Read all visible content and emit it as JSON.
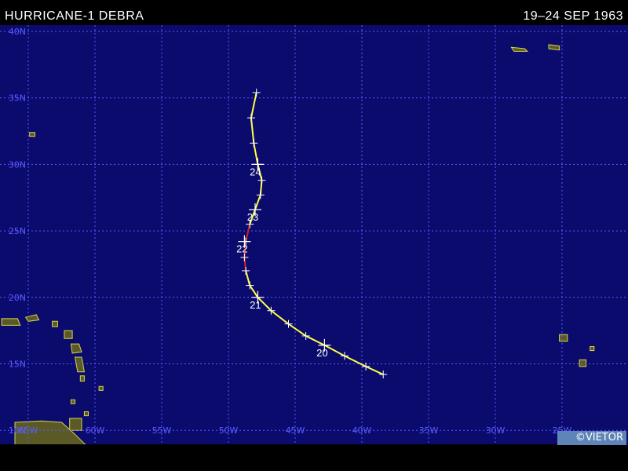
{
  "header": {
    "storm_title": "HURRICANE-1 DEBRA",
    "date_range": "19–24 SEP 1963"
  },
  "credit": "©VIETOR",
  "colors": {
    "ocean": "#0b0b6e",
    "grid": "#5a5aff",
    "land_fill": "#5b5a27",
    "land_outline": "#d6d64a",
    "track_hurricane": "#ffff44",
    "track_storm": "#cc2222",
    "tick": "#ffffff"
  },
  "axes": {
    "lat_labels": [
      "40N",
      "35N",
      "30N",
      "25N",
      "20N",
      "15N",
      "10N"
    ],
    "lon_labels": [
      "65W",
      "60W",
      "55W",
      "50W",
      "45W",
      "40W",
      "35W",
      "30W",
      "25W"
    ]
  },
  "track": {
    "day_labels": [
      {
        "day": "20",
        "lat": 16.4,
        "lon": -42.8
      },
      {
        "day": "21",
        "lat": 20.0,
        "lon": -47.8
      },
      {
        "day": "22",
        "lat": 24.2,
        "lon": -48.8
      },
      {
        "day": "23",
        "lat": 26.6,
        "lon": -48.0
      },
      {
        "day": "24",
        "lat": 30.0,
        "lon": -47.8
      }
    ],
    "points": [
      {
        "lat": 14.2,
        "lon": -38.4,
        "cat": "H"
      },
      {
        "lat": 14.8,
        "lon": -39.7,
        "cat": "H"
      },
      {
        "lat": 15.6,
        "lon": -41.3,
        "cat": "H"
      },
      {
        "lat": 16.4,
        "lon": -42.8,
        "cat": "H"
      },
      {
        "lat": 17.1,
        "lon": -44.2,
        "cat": "H"
      },
      {
        "lat": 18.0,
        "lon": -45.5,
        "cat": "H"
      },
      {
        "lat": 19.0,
        "lon": -46.8,
        "cat": "H"
      },
      {
        "lat": 20.0,
        "lon": -47.8,
        "cat": "H"
      },
      {
        "lat": 20.9,
        "lon": -48.4,
        "cat": "H"
      },
      {
        "lat": 22.0,
        "lon": -48.7,
        "cat": "H"
      },
      {
        "lat": 23.0,
        "lon": -48.8,
        "cat": "S"
      },
      {
        "lat": 24.2,
        "lon": -48.7,
        "cat": "S"
      },
      {
        "lat": 25.5,
        "lon": -48.4,
        "cat": "H"
      },
      {
        "lat": 26.6,
        "lon": -48.0,
        "cat": "H"
      },
      {
        "lat": 27.7,
        "lon": -47.6,
        "cat": "H"
      },
      {
        "lat": 28.8,
        "lon": -47.5,
        "cat": "H"
      },
      {
        "lat": 30.0,
        "lon": -47.8,
        "cat": "H"
      },
      {
        "lat": 31.6,
        "lon": -48.1,
        "cat": "H"
      },
      {
        "lat": 33.5,
        "lon": -48.3,
        "cat": "H"
      },
      {
        "lat": 35.4,
        "lon": -47.9,
        "cat": "H"
      }
    ]
  },
  "land": [
    {
      "name": "bermuda",
      "pts": [
        [
          -64.9,
          32.4
        ],
        [
          -64.5,
          32.4
        ],
        [
          -64.5,
          32.1
        ],
        [
          -64.9,
          32.1
        ]
      ]
    },
    {
      "name": "puerto-rico-area",
      "pts": [
        [
          -67.0,
          18.4
        ],
        [
          -65.8,
          18.4
        ],
        [
          -65.6,
          17.9
        ],
        [
          -67.0,
          17.9
        ]
      ]
    },
    {
      "name": "virgin-islands",
      "pts": [
        [
          -65.2,
          18.5
        ],
        [
          -64.4,
          18.7
        ],
        [
          -64.2,
          18.3
        ],
        [
          -65.0,
          18.2
        ]
      ]
    },
    {
      "name": "leeward-1",
      "pts": [
        [
          -63.2,
          18.2
        ],
        [
          -62.8,
          18.2
        ],
        [
          -62.8,
          17.8
        ],
        [
          -63.2,
          17.8
        ]
      ]
    },
    {
      "name": "leeward-2",
      "pts": [
        [
          -62.3,
          17.5
        ],
        [
          -61.7,
          17.5
        ],
        [
          -61.7,
          16.9
        ],
        [
          -62.3,
          16.9
        ]
      ]
    },
    {
      "name": "guadeloupe",
      "pts": [
        [
          -61.8,
          16.5
        ],
        [
          -61.2,
          16.5
        ],
        [
          -61.0,
          15.9
        ],
        [
          -61.7,
          15.8
        ]
      ]
    },
    {
      "name": "dominica-martinique",
      "pts": [
        [
          -61.5,
          15.5
        ],
        [
          -61.0,
          15.5
        ],
        [
          -60.8,
          14.4
        ],
        [
          -61.3,
          14.4
        ]
      ]
    },
    {
      "name": "st-lucia",
      "pts": [
        [
          -61.1,
          14.1
        ],
        [
          -60.8,
          14.1
        ],
        [
          -60.8,
          13.7
        ],
        [
          -61.1,
          13.7
        ]
      ]
    },
    {
      "name": "barbados",
      "pts": [
        [
          -59.7,
          13.3
        ],
        [
          -59.4,
          13.3
        ],
        [
          -59.4,
          13.0
        ],
        [
          -59.7,
          13.0
        ]
      ]
    },
    {
      "name": "grenada",
      "pts": [
        [
          -61.8,
          12.3
        ],
        [
          -61.5,
          12.3
        ],
        [
          -61.5,
          12.0
        ],
        [
          -61.8,
          12.0
        ]
      ]
    },
    {
      "name": "tobago",
      "pts": [
        [
          -60.8,
          11.4
        ],
        [
          -60.5,
          11.4
        ],
        [
          -60.5,
          11.1
        ],
        [
          -60.8,
          11.1
        ]
      ]
    },
    {
      "name": "trinidad",
      "pts": [
        [
          -61.9,
          10.9
        ],
        [
          -61.0,
          10.9
        ],
        [
          -61.0,
          10.0
        ],
        [
          -61.9,
          10.0
        ]
      ]
    },
    {
      "name": "south-america",
      "pts": [
        [
          -66.0,
          10.6
        ],
        [
          -64.0,
          10.7
        ],
        [
          -62.5,
          10.6
        ],
        [
          -61.5,
          9.7
        ],
        [
          -60.8,
          9.0
        ],
        [
          -60.0,
          8.5
        ],
        [
          -66.0,
          8.5
        ]
      ]
    },
    {
      "name": "azores-1",
      "pts": [
        [
          -28.8,
          38.8
        ],
        [
          -27.8,
          38.7
        ],
        [
          -27.6,
          38.5
        ],
        [
          -28.6,
          38.5
        ]
      ]
    },
    {
      "name": "azores-2",
      "pts": [
        [
          -26.0,
          39.0
        ],
        [
          -25.2,
          38.9
        ],
        [
          -25.2,
          38.6
        ],
        [
          -26.0,
          38.7
        ]
      ]
    },
    {
      "name": "madeira",
      "pts": [
        [
          -17.3,
          32.9
        ],
        [
          -16.7,
          32.9
        ],
        [
          -16.7,
          32.6
        ],
        [
          -17.3,
          32.6
        ]
      ]
    },
    {
      "name": "cape-verde-1",
      "pts": [
        [
          -25.2,
          17.2
        ],
        [
          -24.6,
          17.2
        ],
        [
          -24.6,
          16.7
        ],
        [
          -25.2,
          16.7
        ]
      ]
    },
    {
      "name": "cape-verde-2",
      "pts": [
        [
          -23.7,
          15.3
        ],
        [
          -23.2,
          15.3
        ],
        [
          -23.2,
          14.8
        ],
        [
          -23.7,
          14.8
        ]
      ]
    },
    {
      "name": "cape-verde-3",
      "pts": [
        [
          -22.9,
          16.3
        ],
        [
          -22.6,
          16.3
        ],
        [
          -22.6,
          16.0
        ],
        [
          -22.9,
          16.0
        ]
      ]
    }
  ]
}
